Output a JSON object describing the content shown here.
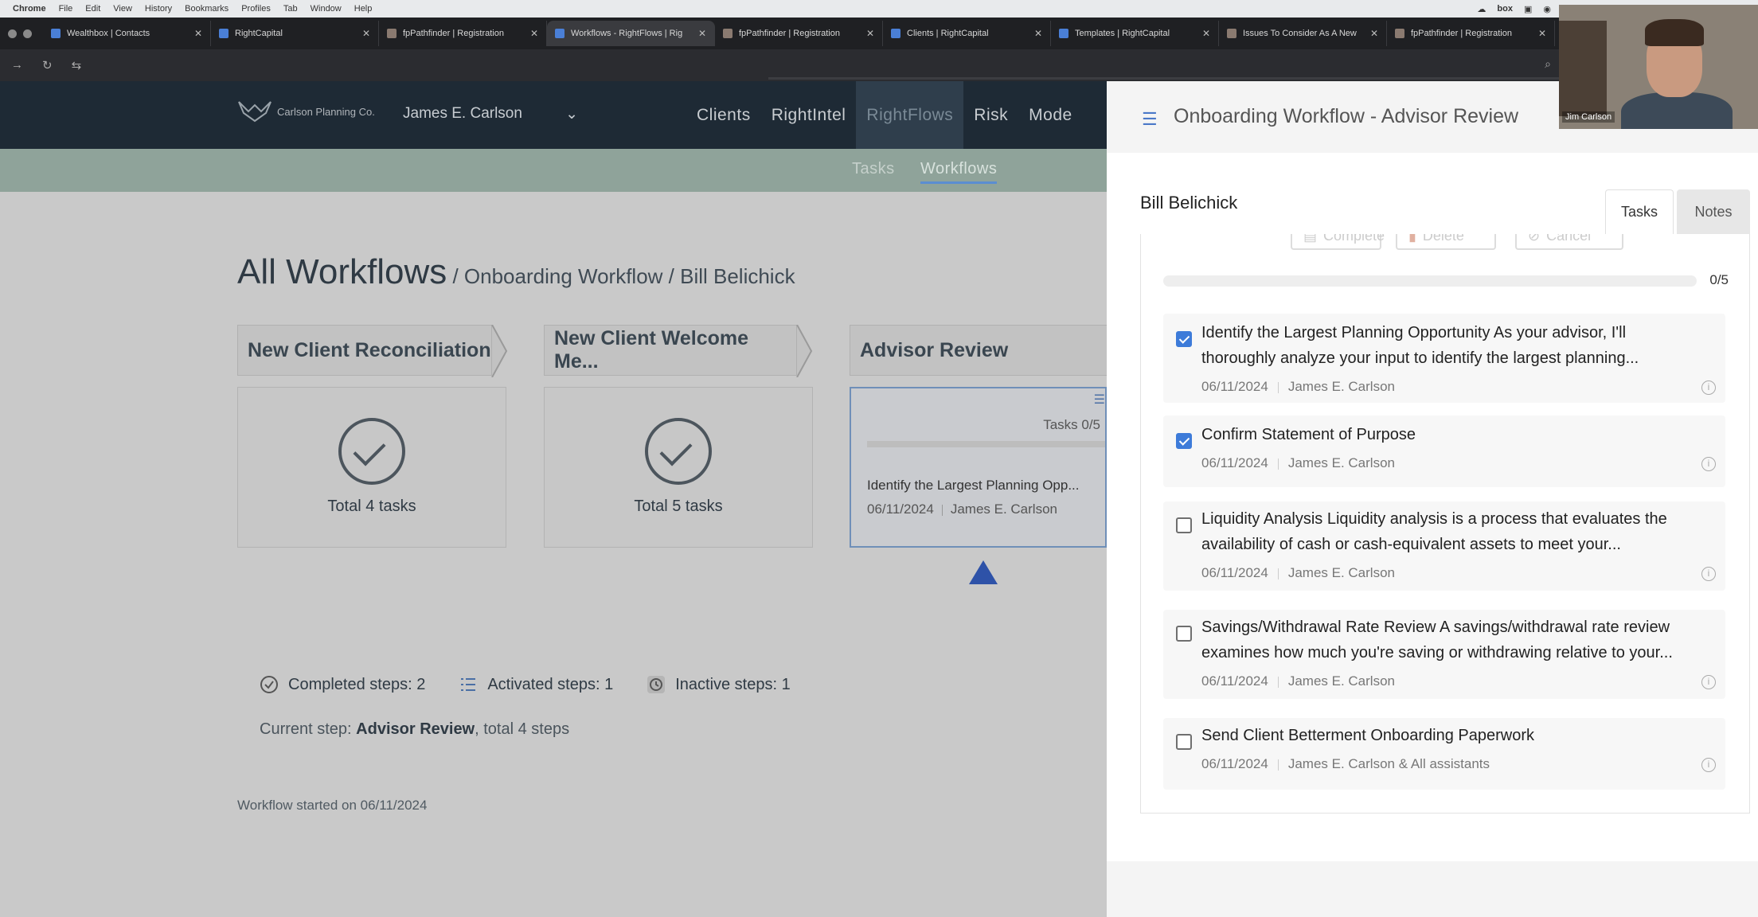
{
  "menubar": {
    "items": [
      "Chrome",
      "File",
      "Edit",
      "View",
      "History",
      "Bookmarks",
      "Profiles",
      "Tab",
      "Window",
      "Help"
    ],
    "box_label": "box"
  },
  "browser": {
    "tabs": [
      {
        "title": "Wealthbox | Contacts"
      },
      {
        "title": "RightCapital"
      },
      {
        "title": "fpPathfinder | Registration"
      },
      {
        "title": "Workflows - RightFlows | Rig"
      },
      {
        "title": "fpPathfinder | Registration"
      },
      {
        "title": "Clients | RightCapital"
      },
      {
        "title": "Templates | RightCapital"
      },
      {
        "title": "Issues To Consider As A New"
      },
      {
        "title": "fpPathfinder | Registration"
      }
    ],
    "active_tab_index": 3
  },
  "app": {
    "logo_text": "Carlson Planning Co.",
    "user_select": "James E. Carlson",
    "nav": [
      "Clients",
      "RightIntel",
      "RightFlows",
      "Risk",
      "Mode"
    ],
    "active_nav": "RightFlows",
    "subnav": [
      "Tasks",
      "Workflows"
    ],
    "active_subnav": "Workflows"
  },
  "breadcrumb": {
    "root": "All Workflows",
    "path": " / Onboarding Workflow / Bill Belichick"
  },
  "steps": [
    {
      "label": "New Client Reconciliation",
      "status": "completed",
      "card_text": "Total 4 tasks"
    },
    {
      "label": "New Client Welcome Me...",
      "status": "completed",
      "card_text": "Total 5 tasks"
    },
    {
      "label": "Advisor Review",
      "status": "active",
      "card_tasks": "Tasks 0/5",
      "card_task_title": "Identify the Largest Planning Opp...",
      "card_task_date": "06/11/2024",
      "card_task_owner": "James E. Carlson"
    }
  ],
  "stats": {
    "completed": "Completed steps: 2",
    "activated": "Activated steps: 1",
    "inactive": "Inactive steps: 1",
    "current_prefix": "Current step: ",
    "current_step": "Advisor Review",
    "current_suffix": ", total 4 steps",
    "started": "Workflow started on 06/11/2024"
  },
  "panel": {
    "title": "Onboarding Workflow - Advisor Review",
    "client": "Bill Belichick",
    "tabs": [
      "Tasks",
      "Notes"
    ],
    "active_tab": "Tasks",
    "actions": [
      "Complete",
      "Delete",
      "Cancel"
    ],
    "progress_text": "0/5",
    "progress_fraction": 0,
    "tasks": [
      {
        "title": "Identify the Largest Planning Opportunity As your advisor, I'll thoroughly analyze your input to identify the largest planning...",
        "date": "06/11/2024",
        "owner": "James E. Carlson",
        "checked": true
      },
      {
        "title": "Confirm Statement of Purpose",
        "date": "06/11/2024",
        "owner": "James E. Carlson",
        "checked": true
      },
      {
        "title": "Liquidity Analysis Liquidity analysis is a process that evaluates the availability of cash or cash-equivalent assets to meet your...",
        "date": "06/11/2024",
        "owner": "James E. Carlson",
        "checked": false
      },
      {
        "title": "Savings/Withdrawal Rate Review A savings/withdrawal rate review examines how much you're saving or withdrawing relative to your...",
        "date": "06/11/2024",
        "owner": "James E. Carlson",
        "checked": false
      },
      {
        "title": "Send Client Betterment Onboarding Paperwork",
        "date": "06/11/2024",
        "owner": "James E. Carlson & All assistants",
        "checked": false
      }
    ]
  },
  "webcam": {
    "name": "Jim Carlson"
  },
  "colors": {
    "accent": "#3d7bd9",
    "nav_bg": "#1e2a35",
    "subnav_bg": "#8fa39a"
  }
}
